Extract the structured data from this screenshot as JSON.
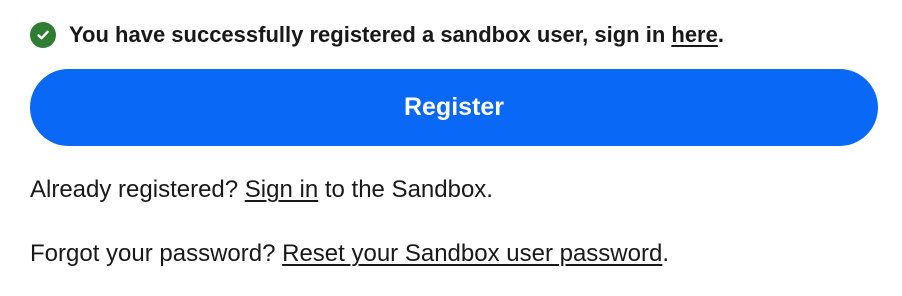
{
  "success_banner": {
    "icon": "check-circle-icon",
    "icon_color": "#2e7d32",
    "message": "You have successfully registered a sandbox user, sign in ",
    "link_text": "here",
    "trailing": "."
  },
  "register_button": {
    "label": "Register",
    "color": "#0968f6"
  },
  "signin_prompt": {
    "prefix": "Already registered? ",
    "link_text": "Sign in",
    "suffix": " to the Sandbox."
  },
  "reset_prompt": {
    "prefix": "Forgot your password? ",
    "link_text": "Reset your Sandbox user password",
    "suffix": "."
  }
}
